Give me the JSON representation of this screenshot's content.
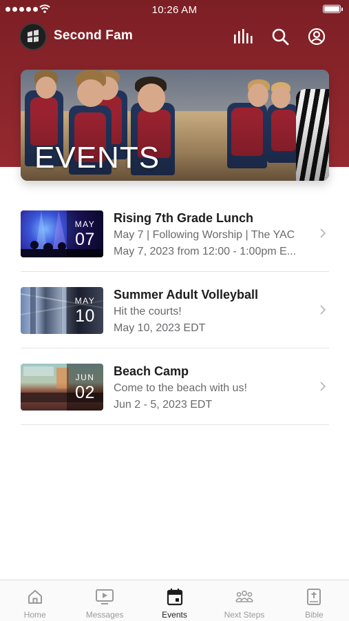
{
  "status_bar": {
    "time": "10:26 AM"
  },
  "app": {
    "title": "Second Fam"
  },
  "hero": {
    "title": "EVENTS"
  },
  "events": [
    {
      "title": "Rising 7th Grade Lunch",
      "subtitle": "May 7 | Following Worship | The YAC",
      "date": "May 7, 2023 from 12:00 - 1:00pm E...",
      "month": "MAY",
      "day": "07"
    },
    {
      "title": "Summer Adult Volleyball",
      "subtitle": "Hit the courts!",
      "date": "May 10, 2023 EDT",
      "month": "MAY",
      "day": "10"
    },
    {
      "title": "Beach Camp",
      "subtitle": "Come to the beach with us!",
      "date": "Jun 2 - 5, 2023 EDT",
      "month": "JUN",
      "day": "02"
    }
  ],
  "tabs": [
    {
      "label": "Home",
      "icon": "home-icon",
      "active": false
    },
    {
      "label": "Messages",
      "icon": "play-screen-icon",
      "active": false
    },
    {
      "label": "Events",
      "icon": "calendar-icon",
      "active": true
    },
    {
      "label": "Next Steps",
      "icon": "group-icon",
      "active": false
    },
    {
      "label": "Bible",
      "icon": "bible-icon",
      "active": false
    }
  ],
  "colors": {
    "header": "#8a252b",
    "active_tab": "#1d1d1f",
    "inactive_tab": "#9a9a9a"
  }
}
